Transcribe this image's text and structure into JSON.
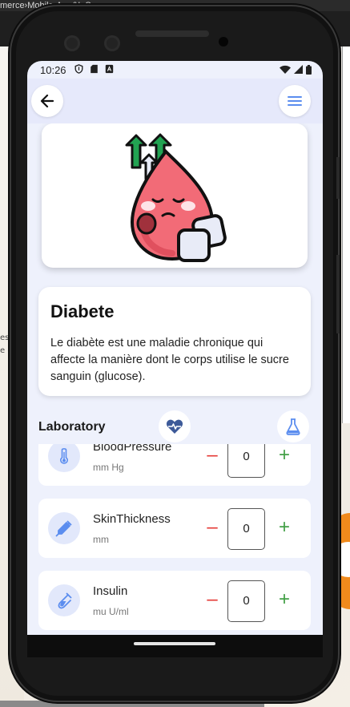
{
  "background": {
    "window_title": "merce›Mobile›App&I_S",
    "left_pane_text": [
      "ess",
      "e de"
    ]
  },
  "status_bar": {
    "time": "10:26",
    "icons": [
      "shield-icon",
      "sd-card-icon",
      "a-badge-icon"
    ],
    "right_icons": [
      "wifi-icon",
      "signal-icon",
      "battery-icon"
    ]
  },
  "app_bar": {
    "back_icon": "arrow-back-icon",
    "menu_icon": "hamburger-menu-icon",
    "accent": "#5b8def"
  },
  "disease": {
    "image": "sad-blood-drop-with-sugar-cubes-illustration",
    "title": "Diabete",
    "description": "Le diabète est une maladie chronique qui affecte la manière dont le corps utilise le sucre sanguin (glucose)."
  },
  "laboratory": {
    "title": "Laboratory",
    "heart_icon": "heart-pulse-icon",
    "flask_icon": "flask-icon",
    "items": [
      {
        "name": "BloodPressure",
        "unit": "mm Hg",
        "value": "0",
        "icon": "thermometer-icon"
      },
      {
        "name": "SkinThickness",
        "unit": "mm",
        "value": "0",
        "icon": "syringe-icon"
      },
      {
        "name": "Insulin",
        "unit": "mu U/ml",
        "value": "0",
        "icon": "test-tube-icon"
      }
    ],
    "minus_label": "–",
    "plus_label": "+"
  },
  "colors": {
    "minus": "#e53935",
    "plus": "#43a047",
    "screen_bg": "#eef1fc",
    "icon_blue": "#5b8def"
  }
}
